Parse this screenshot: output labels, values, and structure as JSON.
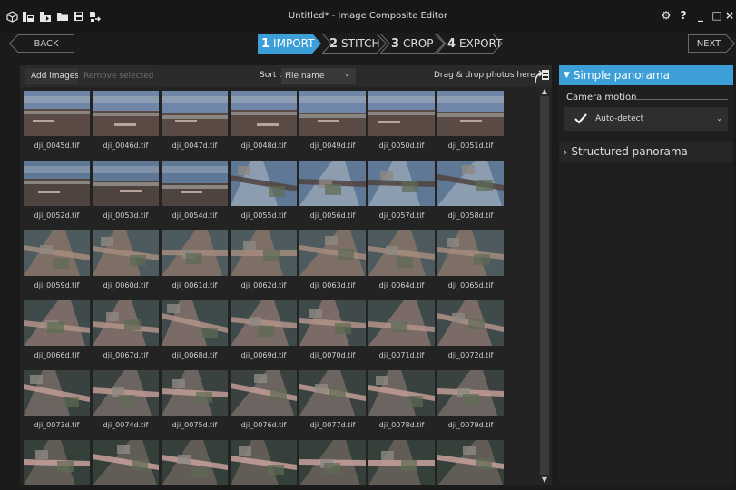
{
  "window": {
    "title": "Untitled* - Image Composite Editor"
  },
  "quick_access": [
    {
      "name": "new-project-icon",
      "glyph": "⬡"
    },
    {
      "name": "new-panorama-from-images-icon",
      "glyph": "▣"
    },
    {
      "name": "new-panorama-from-video-icon",
      "glyph": "▣"
    },
    {
      "name": "open-project-icon",
      "glyph": "▬"
    },
    {
      "name": "save-project-icon",
      "glyph": "■"
    },
    {
      "name": "export-icon",
      "glyph": "⑃"
    }
  ],
  "window_controls": {
    "settings": "⚙",
    "help": "?",
    "minimize": "_",
    "maximize": "□",
    "close": "×"
  },
  "wizard": {
    "back": "BACK",
    "next": "NEXT",
    "steps": [
      {
        "num": "1",
        "label": "IMPORT",
        "active": true
      },
      {
        "num": "2",
        "label": "STITCH",
        "active": false
      },
      {
        "num": "3",
        "label": "CROP",
        "active": false
      },
      {
        "num": "4",
        "label": "EXPORT",
        "active": false
      }
    ]
  },
  "import": {
    "add_images": "Add images...",
    "remove_selected": "Remove selected",
    "sort_label": "Sort by",
    "sort_value": "File name",
    "drag_drop": "Drag & drop photos here",
    "thumbnails": [
      "dji_0045d.tif",
      "dji_0046d.tif",
      "dji_0047d.tif",
      "dji_0048d.tif",
      "dji_0049d.tif",
      "dji_0050d.tif",
      "dji_0051d.tif",
      "dji_0052d.tif",
      "dji_0053d.tif",
      "dji_0054d.tif",
      "dji_0055d.tif",
      "dji_0056d.tif",
      "dji_0057d.tif",
      "dji_0058d.tif",
      "dji_0059d.tif",
      "dji_0060d.tif",
      "dji_0061d.tif",
      "dji_0062d.tif",
      "dji_0063d.tif",
      "dji_0064d.tif",
      "dji_0065d.tif",
      "dji_0066d.tif",
      "dji_0067d.tif",
      "dji_0068d.tif",
      "dji_0069d.tif",
      "dji_0070d.tif",
      "dji_0071d.tif",
      "dji_0072d.tif",
      "dji_0073d.tif",
      "dji_0074d.tif",
      "dji_0075d.tif",
      "dji_0076d.tif",
      "dji_0077d.tif",
      "dji_0078d.tif",
      "dji_0079d.tif",
      "",
      "",
      "",
      "",
      "",
      "",
      ""
    ]
  },
  "panel": {
    "simple_panorama": "Simple panorama",
    "camera_motion": "Camera motion",
    "auto_detect": "Auto-detect",
    "structured_panorama": "Structured panorama"
  },
  "colors": {
    "accent": "#3c9fd8",
    "background": "#1b1b1b",
    "panel": "#232323"
  }
}
